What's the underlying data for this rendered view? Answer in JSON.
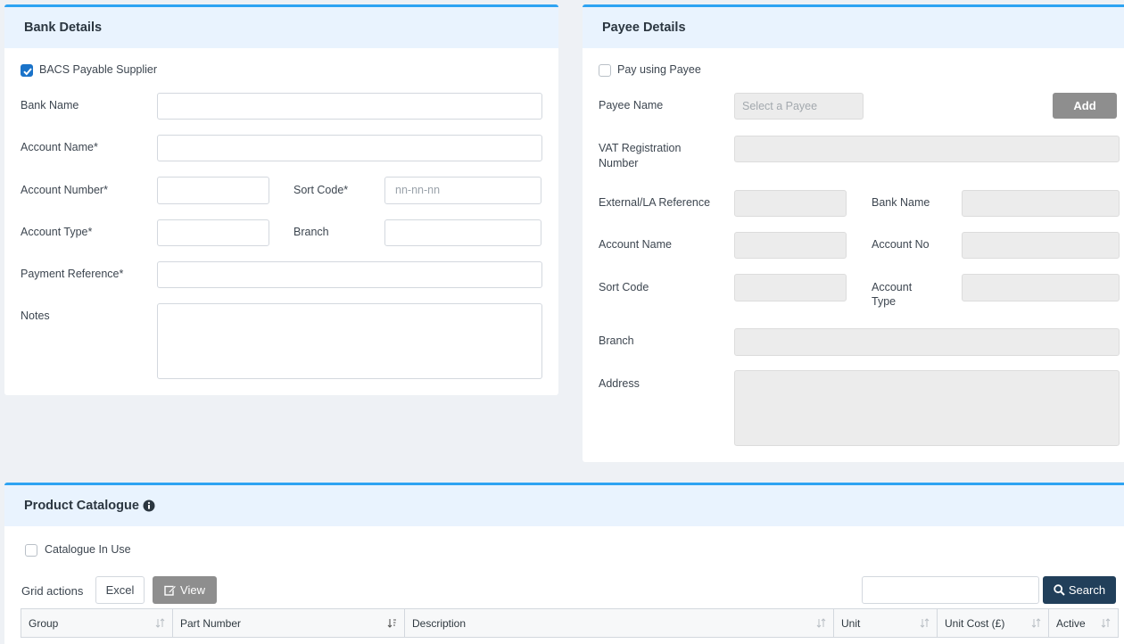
{
  "bank": {
    "title": "Bank Details",
    "bacs_label": "BACS Payable Supplier",
    "bank_name_label": "Bank Name",
    "account_name_label": "Account Name*",
    "account_number_label": "Account Number*",
    "sort_code_label": "Sort Code*",
    "sort_code_placeholder": "nn-nn-nn",
    "account_type_label": "Account Type*",
    "branch_label": "Branch",
    "payment_reference_label": "Payment Reference*",
    "notes_label": "Notes"
  },
  "payee": {
    "title": "Payee Details",
    "pay_using_label": "Pay using Payee",
    "payee_name_label": "Payee Name",
    "payee_placeholder": "Select a Payee",
    "add_label": "Add",
    "vat_label_1": "VAT Registration",
    "vat_label_2": "Number",
    "external_ref_label": "External/LA Reference",
    "bank_name_label": "Bank Name",
    "account_name_label": "Account Name",
    "account_no_label": "Account No",
    "sort_code_label": "Sort Code",
    "account_type_label_1": "Account",
    "account_type_label_2": "Type",
    "branch_label": "Branch",
    "address_label": "Address"
  },
  "catalogue": {
    "title": "Product Catalogue",
    "in_use_label": "Catalogue In Use",
    "grid_actions_label": "Grid actions",
    "excel_label": "Excel",
    "view_label": "View",
    "search_label": "Search",
    "columns": [
      "Group",
      "Part Number",
      "Description",
      "Unit",
      "Unit Cost (£)",
      "Active"
    ]
  },
  "colors": {
    "accent": "#2ea3f2",
    "checkbox_checked": "#1a73c9",
    "search_button": "#213f5a",
    "view_button": "#8e8e8e"
  }
}
